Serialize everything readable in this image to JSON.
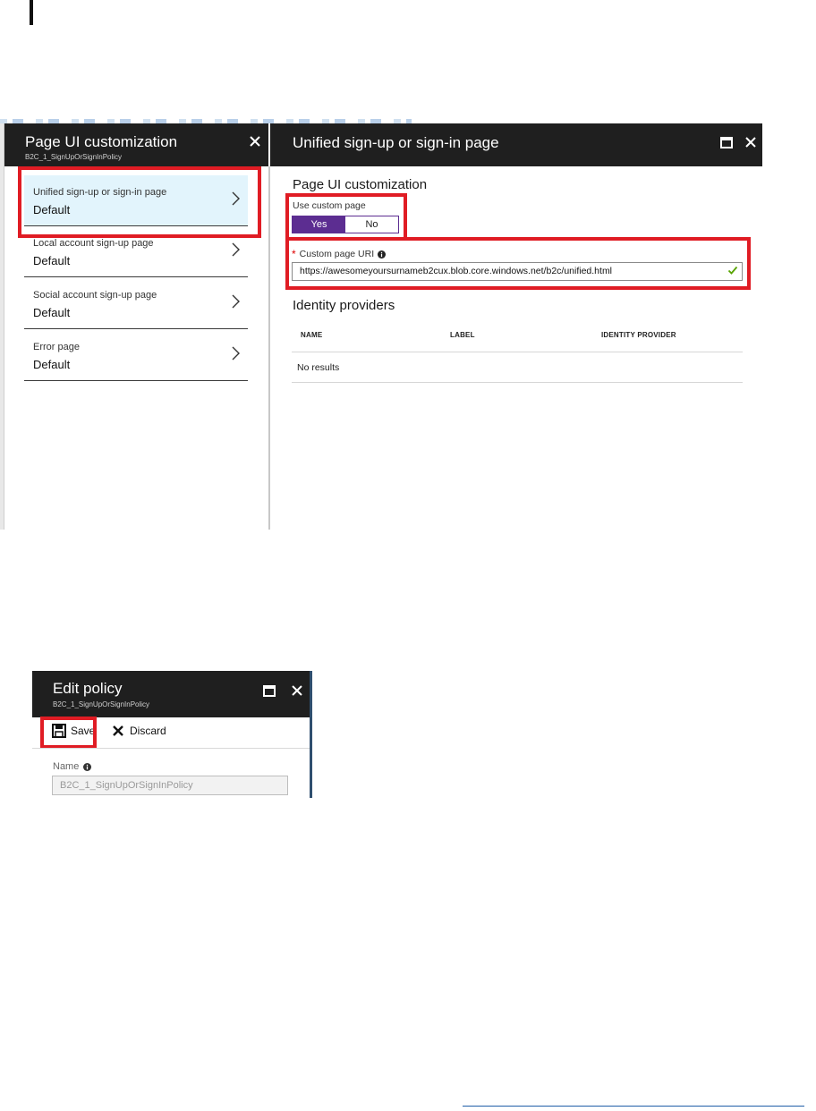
{
  "blade1": {
    "title": "Page UI customization",
    "subtitle": "B2C_1_SignUpOrSignInPolicy",
    "items": [
      {
        "label": "Unified sign-up or sign-in page",
        "value": "Default"
      },
      {
        "label": "Local account sign-up page",
        "value": "Default"
      },
      {
        "label": "Social account sign-up page",
        "value": "Default"
      },
      {
        "label": "Error page",
        "value": "Default"
      }
    ]
  },
  "blade2": {
    "title": "Unified sign-up or sign-in page",
    "section_title": "Page UI customization",
    "use_custom_page_label": "Use custom page",
    "toggle": {
      "yes": "Yes",
      "no": "No",
      "selected": "Yes"
    },
    "required_marker": "*",
    "custom_uri_label": "Custom page URI",
    "custom_uri_value": "https://awesomeyoursurnameb2cux.blob.core.windows.net/b2c/unified.html",
    "identity_providers_title": "Identity providers",
    "table": {
      "columns": [
        "NAME",
        "LABEL",
        "IDENTITY PROVIDER"
      ],
      "empty_text": "No results"
    }
  },
  "edit_policy": {
    "title": "Edit policy",
    "subtitle": "B2C_1_SignUpOrSignInPolicy",
    "save_label": "Save",
    "discard_label": "Discard",
    "name_label": "Name",
    "name_value": "B2C_1_SignUpOrSignInPolicy"
  },
  "colors": {
    "header_bg": "#1f1f1f",
    "accent_purple": "#5c2d91",
    "highlight_red": "#e01c24",
    "selected_bg": "#e2f4fc",
    "valid_green": "#57a300"
  },
  "icons": [
    "chevron-right-icon",
    "close-icon",
    "maximize-icon",
    "info-icon",
    "checkmark-icon",
    "save-icon",
    "discard-icon"
  ]
}
